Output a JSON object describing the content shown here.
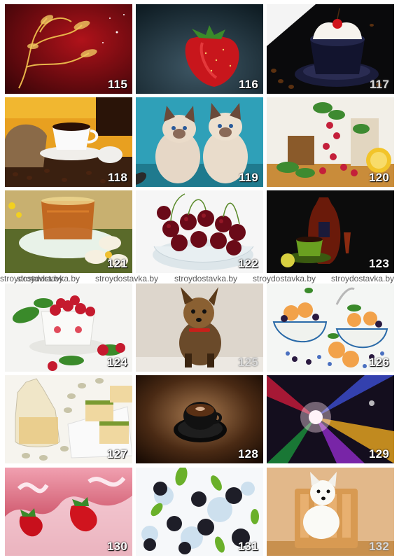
{
  "grid": {
    "tiles": [
      {
        "number": "115",
        "subject": "golden floral ornament on red"
      },
      {
        "number": "116",
        "subject": "strawberry"
      },
      {
        "number": "117",
        "subject": "cup with cream and cherry on coffee beans"
      },
      {
        "number": "118",
        "subject": "coffee cup with coffee beans and sack"
      },
      {
        "number": "119",
        "subject": "two kittens"
      },
      {
        "number": "120",
        "subject": "raspberries with mint and lemon"
      },
      {
        "number": "121",
        "subject": "tea cup with flowers"
      },
      {
        "number": "122",
        "subject": "cherries in glass bowl"
      },
      {
        "number": "123",
        "subject": "cognac bottle and green cup"
      },
      {
        "number": "124",
        "subject": "cup of raspberries"
      },
      {
        "number": "125",
        "subject": "yorkshire terrier puppy"
      },
      {
        "number": "126",
        "subject": "bowls of apricots and berries"
      },
      {
        "number": "127",
        "subject": "honey jug, pistachios and pastries"
      },
      {
        "number": "128",
        "subject": "black coffee cup"
      },
      {
        "number": "129",
        "subject": "colorful abstract light rays"
      },
      {
        "number": "130",
        "subject": "strawberries splashing in milk"
      },
      {
        "number": "131",
        "subject": "blackberries in water splash"
      },
      {
        "number": "132",
        "subject": "white terrier puppy on chair"
      }
    ]
  },
  "watermark": {
    "texts": [
      "stroydostavka.by",
      "stroydostavka.by",
      "stroydostavka.by",
      "stroydostavka.by",
      "stroydostavka.by",
      "stroydostavka.by"
    ]
  }
}
